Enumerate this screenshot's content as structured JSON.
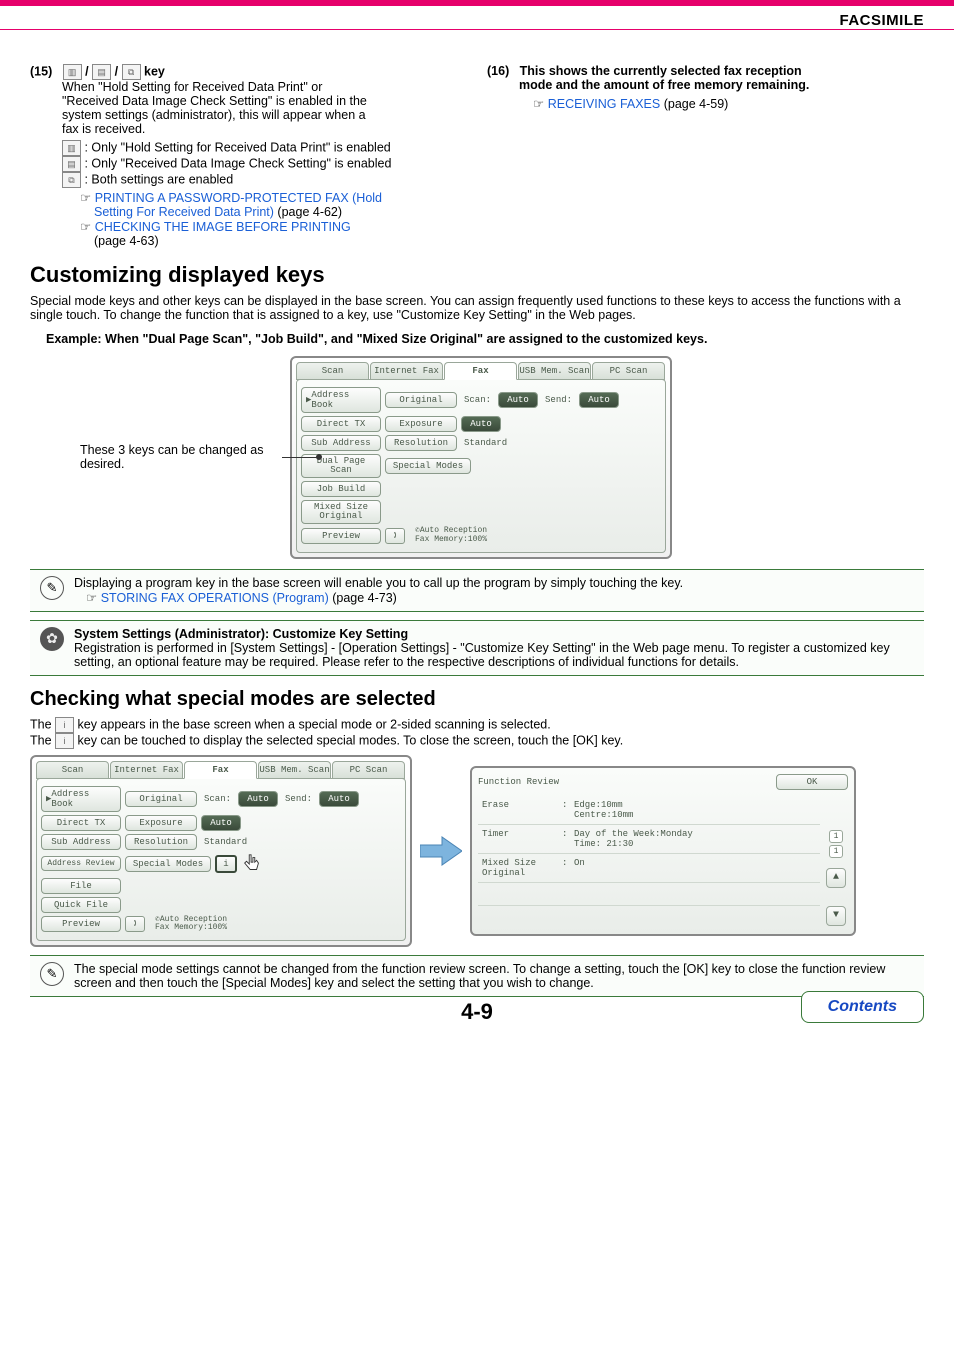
{
  "header": {
    "title": "FACSIMILE"
  },
  "item15": {
    "number": "(15)",
    "icon_sep": " / ",
    "key_word": " key",
    "intro_line1": "When \"Hold Setting for Received Data Print\" or",
    "intro_line2": "\"Received Data Image Check Setting\" is enabled in the",
    "intro_line3": "system settings (administrator), this will appear when a",
    "intro_line4": "fax is received.",
    "opt_a": " :  Only \"Hold Setting for Received Data Print\" is enabled",
    "opt_b": " :  Only \"Received Data Image Check Setting\" is enabled",
    "opt_c": " :  Both settings are enabled",
    "link1a": "PRINTING A PASSWORD-PROTECTED FAX (Hold",
    "link1b": "Setting For Received Data Print)",
    "link1_tail": " (page 4-62)",
    "link2": "CHECKING THE IMAGE BEFORE PRINTING",
    "link2_tail": "(page 4-63)"
  },
  "item16": {
    "number": "(16)",
    "line1": "This shows the currently selected fax reception",
    "line2": "mode and the amount of free memory remaining.",
    "link": "RECEIVING FAXES",
    "link_tail": " (page 4-59)",
    "arrow": "☞"
  },
  "section1": {
    "heading": "Customizing displayed keys",
    "para": "Special mode keys and other keys can be displayed in the base screen. You can assign frequently used functions to these keys to access the functions with a single touch. To change the function that is assigned to a key, use \"Customize Key Setting\" in the Web pages.",
    "example": "Example: When \"Dual Page Scan\", \"Job Build\", and \"Mixed Size Original\" are assigned to the customized keys.",
    "caption": "These 3 keys can be changed as desired."
  },
  "panel1": {
    "tabs": [
      "Scan",
      "Internet Fax",
      "Fax",
      "USB Mem. Scan",
      "PC Scan"
    ],
    "rows": {
      "address_book": "Address Book",
      "original": "Original",
      "scan_label": "Scan:",
      "auto1": "Auto",
      "send_label": "Send:",
      "auto2": "Auto",
      "direct_tx": "Direct TX",
      "exposure": "Exposure",
      "auto3": "Auto",
      "sub_address": "Sub Address",
      "resolution": "Resolution",
      "standard": "Standard",
      "dual_page": "Dual Page\nScan",
      "special_modes": "Special Modes",
      "job_build": "Job Build",
      "mixed_size": "Mixed Size\nOriginal",
      "preview": "Preview",
      "status1": "Auto Reception",
      "status2": "Fax Memory:100%"
    }
  },
  "note1": {
    "text_a": "Displaying a program key in the base screen will enable you to call up the program by simply touching the key.",
    "link": "STORING FAX OPERATIONS (Program)",
    "link_tail": " (page 4-73)",
    "arrow": "☞"
  },
  "note2": {
    "title": "System Settings (Administrator): Customize Key Setting",
    "body": "Registration is performed in [System Settings] - [Operation Settings] - \"Customize Key Setting\" in the Web page menu. To register a customized key setting, an optional feature may be required. Please refer to the respective descriptions of individual functions for details."
  },
  "section2": {
    "heading": "Checking what special modes are selected",
    "line1a": "The ",
    "line1b": " key appears in the base screen when a special mode or 2-sided scanning is selected.",
    "line2a": "The ",
    "line2b": " key can be touched to display the selected special modes. To close the screen, touch the [OK] key."
  },
  "panel2": {
    "tabs": [
      "Scan",
      "Internet Fax",
      "Fax",
      "USB Mem. Scan",
      "PC Scan"
    ],
    "rows": {
      "address_book": "Address Book",
      "original": "Original",
      "scan_label": "Scan:",
      "auto1": "Auto",
      "send_label": "Send:",
      "auto2": "Auto",
      "direct_tx": "Direct TX",
      "exposure": "Exposure",
      "auto3": "Auto",
      "sub_address": "Sub Address",
      "resolution": "Resolution",
      "standard": "Standard",
      "address_review": "Address Review",
      "special_modes": "Special Modes",
      "file": "File",
      "quick_file": "Quick File",
      "preview": "Preview",
      "status1": "Auto Reception",
      "status2": "Fax Memory:100%"
    }
  },
  "review": {
    "title": "Function Review",
    "ok": "OK",
    "rows": [
      {
        "label": "Erase",
        "value": "Edge:10mm\nCentre:10mm"
      },
      {
        "label": "Timer",
        "value": "Day of the Week:Monday\nTime: 21:30"
      },
      {
        "label": "Mixed Size\nOriginal",
        "value": "On"
      }
    ],
    "scroll": {
      "page_cur": "1",
      "page_total": "1",
      "up": "▲",
      "down": "▼"
    }
  },
  "note3": {
    "text": "The special mode settings cannot be changed from the function review screen. To change a setting, touch the [OK] key to close the function review screen and then touch the [Special Modes] key and select the setting that you wish to change."
  },
  "footer": {
    "page": "4-9",
    "contents": "Contents"
  },
  "icons": {
    "doc": "▥",
    "sheet": "▤",
    "both": "⧉",
    "info": "i",
    "phone": "✆"
  }
}
